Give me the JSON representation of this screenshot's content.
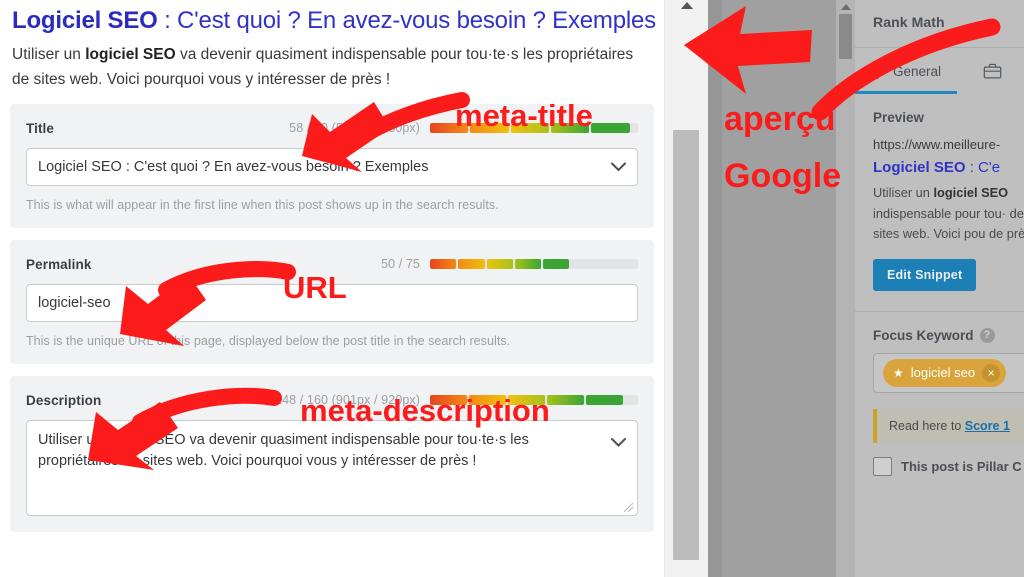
{
  "serp_preview": {
    "title_bold": "Logiciel SEO",
    "title_rest": " : C'est quoi ? En avez-vous besoin ? Exemples",
    "desc_part1": "Utiliser un ",
    "desc_bold": "logiciel SEO",
    "desc_part2": " va devenir quasiment indispensable pour tou·te·s les propriétaires de sites web. Voici pourquoi vous y intéresser de près !"
  },
  "title_field": {
    "label": "Title",
    "counter": "58 / 60 (559px / 580px)",
    "value": "Logiciel SEO : C'est quoi ? En avez-vous besoin ? Exemples",
    "help": "This is what will appear in the first line when this post shows up in the search results.",
    "strength_percent": 96
  },
  "permalink_field": {
    "label": "Permalink",
    "counter": "50 / 75",
    "value": "logiciel-seo",
    "help": "This is the unique URL of this page, displayed below the post title in the search results.",
    "strength_percent": 67
  },
  "description_field": {
    "label": "Description",
    "counter": "148 / 160 (901px / 920px)",
    "value": "Utiliser un logiciel SEO va devenir quasiment indispensable pour tou·te·s les propriétaires de sites web. Voici pourquoi vous y intéresser de près !",
    "strength_percent": 93
  },
  "strength_colors": [
    "#e8431f",
    "#f58a13",
    "#f0c010",
    "#a8c21a",
    "#3aa533"
  ],
  "sidebar": {
    "title": "Rank Math",
    "tabs": [
      {
        "label": "General",
        "icon": "gear-icon",
        "active": true
      },
      {
        "label": "",
        "icon": "briefcase-icon",
        "active": false
      }
    ],
    "preview_heading": "Preview",
    "snippet_url": "https://www.meilleure-",
    "snippet_title_bold": "Logiciel SEO",
    "snippet_title_rest": " : C'e",
    "snippet_desc_p1": "Utiliser un ",
    "snippet_desc_bold": "logiciel SEO",
    "snippet_desc_p2": " indispensable pour tou· de sites web. Voici pou de près !",
    "edit_snippet_label": "Edit Snippet",
    "focus_keyword_label": "Focus Keyword",
    "help_glyph": "?",
    "keyword_tag": "logiciel seo",
    "keyword_star": "★",
    "keyword_remove": "×",
    "notice_text": "Read here to ",
    "notice_link": "Score 1",
    "pillar_label": "This post is Pillar C",
    "accent_blue": "#1c89c4",
    "button_blue": "#1c7fb5",
    "keyword_gold": "#d9a43c"
  },
  "annotations": {
    "meta_title": "meta-title",
    "url": "URL",
    "meta_description": "meta-description",
    "apercu_line1": "aperçu",
    "apercu_line2": "Google",
    "color": "#fb1b1b"
  }
}
